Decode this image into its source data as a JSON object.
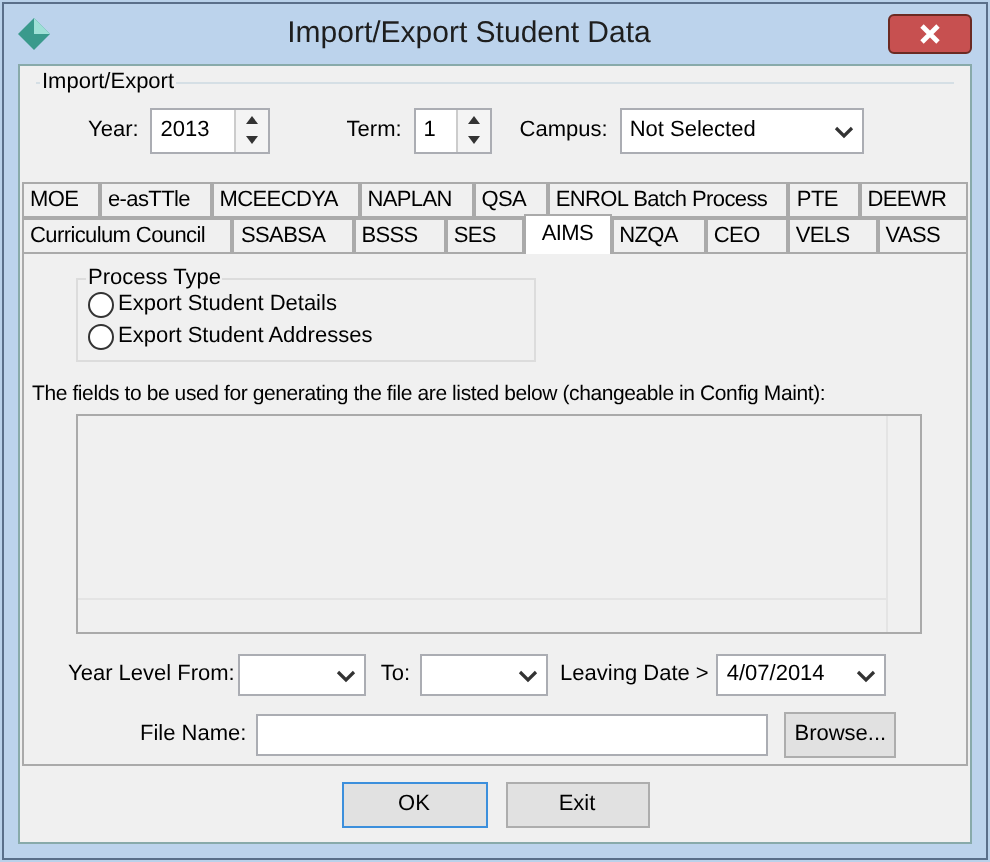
{
  "window": {
    "title": "Import/Export Student Data"
  },
  "import_export": {
    "title": "Import/Export",
    "year": {
      "label": "Year:",
      "value": "2013"
    },
    "term": {
      "label": "Term:",
      "value": "1"
    },
    "campus": {
      "label": "Campus:",
      "value": "Not Selected"
    }
  },
  "tab_rows": [
    [
      {
        "label": "MOE",
        "selected": false
      },
      {
        "label": "e-asTTle",
        "selected": false
      },
      {
        "label": "MCEECDYA",
        "selected": false
      },
      {
        "label": "NAPLAN",
        "selected": false
      },
      {
        "label": "QSA",
        "selected": false
      },
      {
        "label": "ENROL Batch Process",
        "selected": false
      },
      {
        "label": "PTE",
        "selected": false
      },
      {
        "label": "DEEWR",
        "selected": false
      }
    ],
    [
      {
        "label": "Curriculum Council",
        "selected": false
      },
      {
        "label": "SSABSA",
        "selected": false
      },
      {
        "label": "BSSS",
        "selected": false
      },
      {
        "label": "SES",
        "selected": false
      },
      {
        "label": "AIMS",
        "selected": true
      },
      {
        "label": "NZQA",
        "selected": false
      },
      {
        "label": "CEO",
        "selected": false
      },
      {
        "label": "VELS",
        "selected": false
      },
      {
        "label": "VASS",
        "selected": false
      }
    ]
  ],
  "process_type": {
    "title": "Process Type",
    "options": [
      {
        "label": "Export Student Details",
        "selected": false
      },
      {
        "label": "Export Student Addresses",
        "selected": false
      }
    ]
  },
  "fields_caption": "The fields to be used for generating the file are listed below (changeable in Config Maint):",
  "year_level_from": {
    "label": "Year Level From:"
  },
  "to": {
    "label": "To:"
  },
  "leaving_date": {
    "label": "Leaving Date >",
    "value": "4/07/2014"
  },
  "file_name": {
    "label": "File Name:",
    "browse": "Browse..."
  },
  "buttons": [
    "OK",
    "Exit"
  ]
}
